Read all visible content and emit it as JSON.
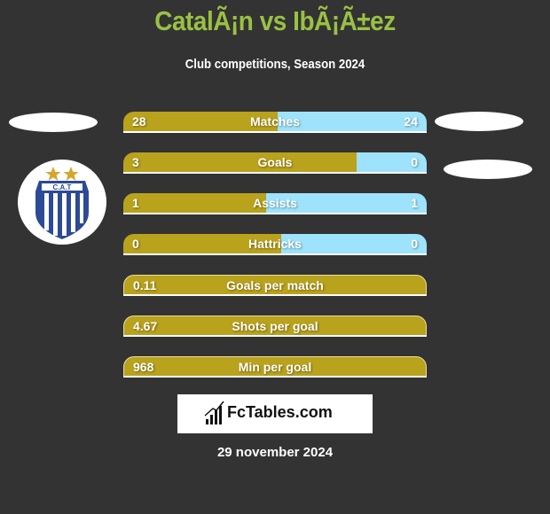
{
  "header": {
    "title": "CatalÃ¡n vs IbÃ¡Ã±ez",
    "subtitle": "Club competitions, Season 2024"
  },
  "team_left": {
    "logo_text": "C.A.T",
    "logo_icon": "club-crest-icon"
  },
  "colors": {
    "left": "#b9a21c",
    "right": "#9ee3fb",
    "title": "#9ac044",
    "background": "#333333"
  },
  "stats": [
    {
      "label": "Matches",
      "left": "28",
      "right": "24",
      "left_fraction": 0.51
    },
    {
      "label": "Goals",
      "left": "3",
      "right": "0",
      "left_fraction": 0.77
    },
    {
      "label": "Assists",
      "left": "1",
      "right": "1",
      "left_fraction": 0.47
    },
    {
      "label": "Hattricks",
      "left": "0",
      "right": "0",
      "left_fraction": 0.52
    },
    {
      "label": "Goals per match",
      "left": "0.11"
    },
    {
      "label": "Shots per goal",
      "left": "4.67"
    },
    {
      "label": "Min per goal",
      "left": "968"
    }
  ],
  "brand": {
    "text": "FcTables.com",
    "icon": "bar-chart-icon"
  },
  "date": "29 november 2024"
}
